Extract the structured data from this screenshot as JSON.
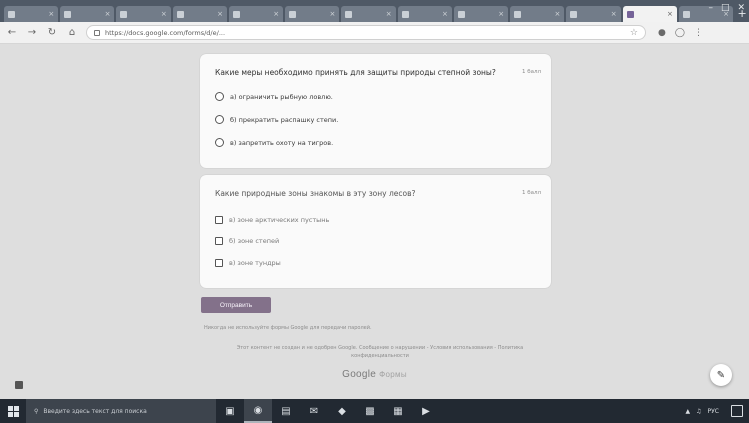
{
  "browser": {
    "tabs": [
      {
        "title": ""
      },
      {
        "title": ""
      },
      {
        "title": ""
      },
      {
        "title": ""
      },
      {
        "title": ""
      },
      {
        "title": ""
      },
      {
        "title": ""
      },
      {
        "title": ""
      },
      {
        "title": ""
      },
      {
        "title": ""
      },
      {
        "title": ""
      },
      {
        "title": "",
        "active": true
      },
      {
        "title": ""
      }
    ],
    "url": "https://docs.google.com/forms/d/e/...",
    "accent": "#7b5fb0"
  },
  "form": {
    "questions": [
      {
        "title": "Какие меры необходимо принять для защиты природы степной зоны?",
        "points": "1 балл",
        "type": "radio",
        "options": [
          {
            "label": "а) ограничить рыбную ловлю."
          },
          {
            "label": "б) прекратить распашку степи."
          },
          {
            "label": "в) запретить охоту на тигров."
          }
        ]
      },
      {
        "title": "Какие природные зоны знакомы в эту зону лесов?",
        "points": "1 балл",
        "type": "checkbox",
        "options": [
          {
            "label": "в) зоне арктических пустынь"
          },
          {
            "label": "б) зоне степей"
          },
          {
            "label": "в) зоне тундры"
          }
        ]
      }
    ],
    "submit_label": "Отправить",
    "footnote": "Никогда не используйте формы Google для передачи паролей.",
    "legal": "Этот контент не создан и не одобрен Google. Сообщение о нарушении - Условия использования - Политика конфиденциальности",
    "brand": {
      "google": "Google",
      "forms": "Формы"
    },
    "accent": "#8a6e94"
  },
  "taskbar": {
    "search_placeholder": "Введите здесь текст для поиска",
    "apps": [
      "file-explorer-icon",
      "chrome-icon",
      "mail-icon",
      "store-icon",
      "word-icon",
      "excel-icon",
      "powerpoint-icon",
      "media-icon"
    ],
    "tray": {
      "lang": "РУС",
      "time": "",
      "date": ""
    }
  }
}
